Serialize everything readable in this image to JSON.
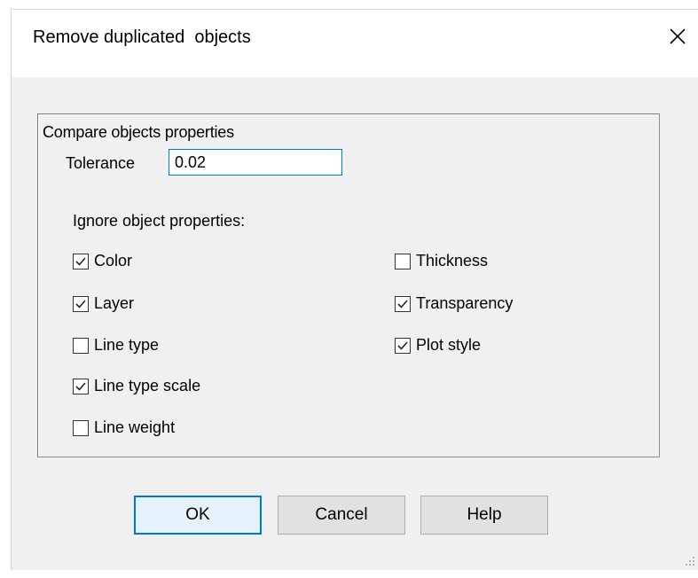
{
  "window": {
    "title": "Remove duplicated  objects"
  },
  "group": {
    "label": "Compare objects properties",
    "tolerance_label": "Tolerance",
    "tolerance_value": "0.02",
    "ignore_label": "Ignore object properties:"
  },
  "checkboxes": {
    "color": {
      "label": "Color",
      "checked": true
    },
    "layer": {
      "label": "Layer",
      "checked": true
    },
    "line_type": {
      "label": "Line type",
      "checked": false
    },
    "line_type_scale": {
      "label": "Line type scale",
      "checked": true
    },
    "line_weight": {
      "label": "Line weight",
      "checked": false
    },
    "thickness": {
      "label": "Thickness",
      "checked": false
    },
    "transparency": {
      "label": "Transparency",
      "checked": true
    },
    "plot_style": {
      "label": "Plot style",
      "checked": true
    }
  },
  "buttons": {
    "ok": "OK",
    "cancel": "Cancel",
    "help": "Help"
  },
  "colors": {
    "accent": "#0078d7",
    "dialog_bg": "#f0f0f0",
    "button_bg": "#e1e1e1"
  }
}
